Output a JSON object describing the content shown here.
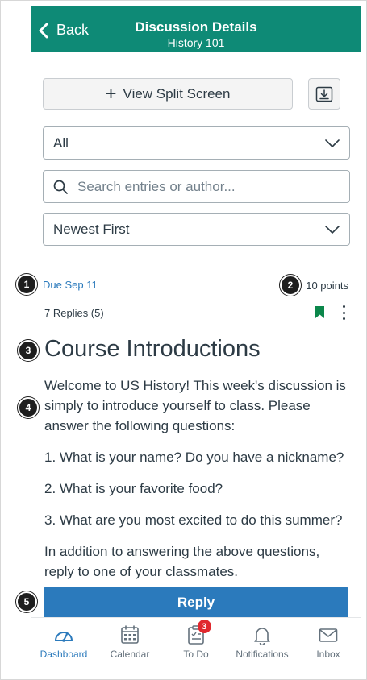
{
  "header": {
    "back_label": "Back",
    "title": "Discussion Details",
    "subtitle": "History 101",
    "color": "#0e8a76"
  },
  "toolbar": {
    "split_screen_label": "View Split Screen",
    "download_icon": "download-icon"
  },
  "filters": {
    "filter_value": "All",
    "search_placeholder": "Search entries or author...",
    "sort_value": "Newest First"
  },
  "discussion": {
    "due": "Due Sep 11",
    "points": "10 points",
    "replies": "7 Replies (5)",
    "title": "Course Introductions",
    "paragraphs": [
      "Welcome to US History! This week's discussion is simply to introduce yourself to class. Please answer the following questions:",
      "1. What is your name? Do you have a nickname?",
      "2. What is your favorite food?",
      "3. What are you most excited to do this summer?",
      "In addition to answering the above questions, reply to one of your classmates."
    ],
    "reply_label": "Reply",
    "bookmark_color": "#0b874b"
  },
  "callouts": [
    "1",
    "2",
    "3",
    "4",
    "5"
  ],
  "tabbar": {
    "items": [
      {
        "label": "Dashboard",
        "icon": "dashboard-icon",
        "active": true
      },
      {
        "label": "Calendar",
        "icon": "calendar-icon",
        "active": false
      },
      {
        "label": "To Do",
        "icon": "todo-icon",
        "badge": "3",
        "active": false
      },
      {
        "label": "Notifications",
        "icon": "bell-icon",
        "active": false
      },
      {
        "label": "Inbox",
        "icon": "inbox-icon",
        "active": false
      }
    ],
    "accent": "#2b7abc"
  }
}
